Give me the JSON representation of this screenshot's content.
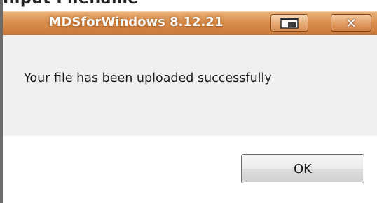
{
  "background_text": "Input Filename",
  "dialog": {
    "title": "MDSforWindows 8.12.21",
    "message": "Your file has been uploaded successfully",
    "ok_label": "OK",
    "close_glyph": "✕"
  },
  "icons": {
    "restore": "restore-icon",
    "close": "close-icon"
  },
  "colors": {
    "titlebar": "#d98f4d",
    "content_bg": "#f0f0f0",
    "footer_bg": "#ffffff"
  }
}
